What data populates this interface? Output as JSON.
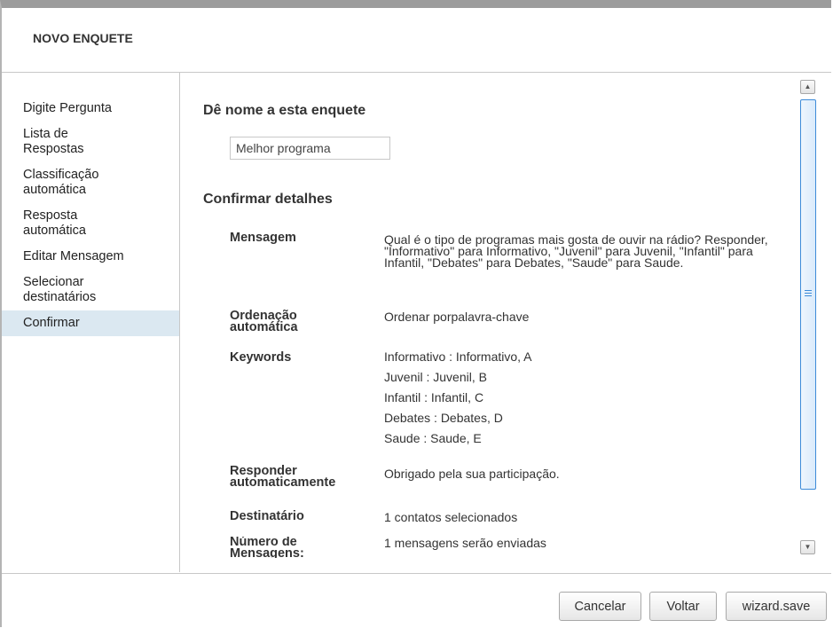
{
  "header": {
    "title": "NOVO ENQUETE"
  },
  "sidebar": {
    "items": [
      {
        "label": "Digite Pergunta"
      },
      {
        "label": "Lista de Respostas"
      },
      {
        "label": "Classificação automática"
      },
      {
        "label": "Resposta automática"
      },
      {
        "label": "Editar Mensagem"
      },
      {
        "label": "Selecionar destinatários"
      },
      {
        "label": "Confirmar"
      }
    ],
    "active": "Confirmar"
  },
  "main": {
    "name_section": {
      "title": "Dê nome a esta enquete",
      "input_value": "Melhor programa"
    },
    "details": {
      "title": "Confirmar detalhes",
      "message_label": "Mensagem",
      "message_value": "Qual é o tipo de programas mais gosta de ouvir na rádio? Responder, \"Informativo\" para Informativo, \"Juvenil\" para Juvenil, \"Infantil\" para Infantil, \"Debates\" para Debates, \"Saude\" para Saude.",
      "sorting_label": "Ordenação automática",
      "sorting_value": "Ordenar porpalavra-chave",
      "keywords_label": "Keywords",
      "keywords": [
        "Informativo : Informativo, A",
        "Juvenil : Juvenil, B",
        "Infantil : Infantil, C",
        "Debates : Debates, D",
        "Saude : Saude, E"
      ],
      "autoreply_label": "Responder automaticamente",
      "autoreply_value": "Obrigado pela sua participação.",
      "recipient_label": "Destinatário",
      "recipient_value": "1 contatos selecionados",
      "count_label": "Número de Mensagens:",
      "count_value": "1 mensagens serão enviadas"
    }
  },
  "footer": {
    "cancel_label": "Cancelar",
    "back_label": "Voltar",
    "save_label": "wizard.save"
  },
  "colors": {
    "active_nav_bg": "#dbe8f1",
    "scrollbar_accent": "#3d8bd8"
  }
}
